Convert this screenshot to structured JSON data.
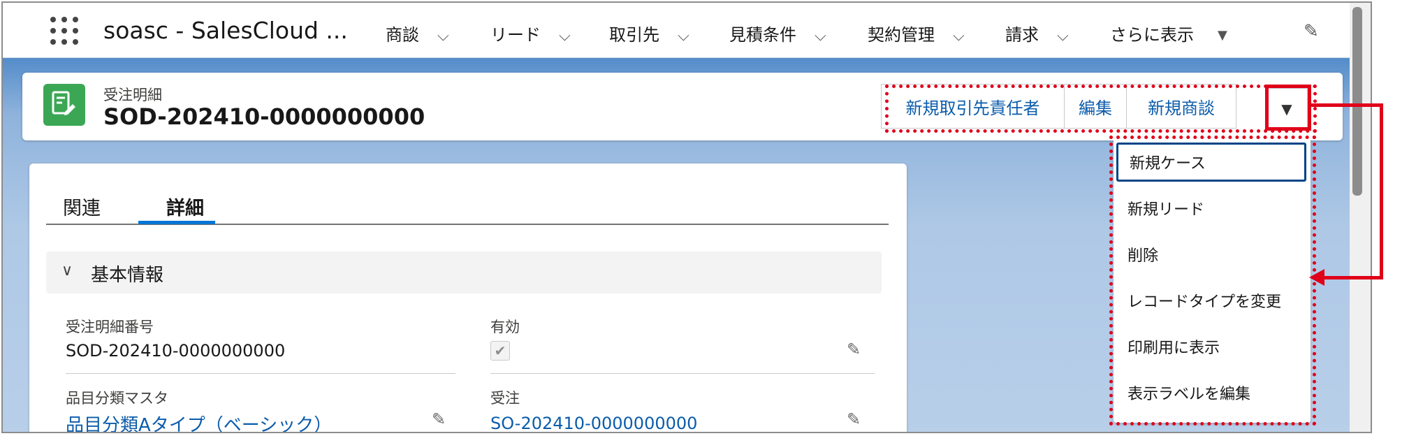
{
  "nav": {
    "app_title": "soasc - SalesCloud ...",
    "items": [
      {
        "label": "商談"
      },
      {
        "label": "リード"
      },
      {
        "label": "取引先"
      },
      {
        "label": "見積条件"
      },
      {
        "label": "契約管理"
      },
      {
        "label": "請求"
      }
    ],
    "more_label": "さらに表示",
    "icons": {
      "launcher": "app-launcher-icon",
      "edit": "pencil-icon"
    }
  },
  "record": {
    "type_label": "受注明細",
    "name": "SOD-202410-0000000000",
    "icon": "order-line-icon",
    "icon_color": "#3ba755"
  },
  "actions": {
    "buttons": [
      "新規取引先責任者",
      "編集",
      "新規商談"
    ],
    "dropdown_icon": "caret-down-icon"
  },
  "menu": {
    "items": [
      "新規ケース",
      "新規リード",
      "削除",
      "レコードタイプを変更",
      "印刷用に表示",
      "表示ラベルを編集"
    ]
  },
  "detail": {
    "tabs": [
      "関連",
      "詳細"
    ],
    "active_tab": "詳細",
    "section_title": "基本情報",
    "fields": {
      "line_number": {
        "label": "受注明細番号",
        "value": "SOD-202410-0000000000"
      },
      "active": {
        "label": "有効",
        "checked": true
      },
      "category_master": {
        "label": "品目分類マスタ",
        "value": "品目分類Aタイプ（ベーシック）"
      },
      "order": {
        "label": "受注",
        "value": "SO-202410-0000000000"
      }
    }
  },
  "colors": {
    "annotation": "#e0001a",
    "link": "#0b5cab",
    "brand_blue": "#0176d3"
  }
}
